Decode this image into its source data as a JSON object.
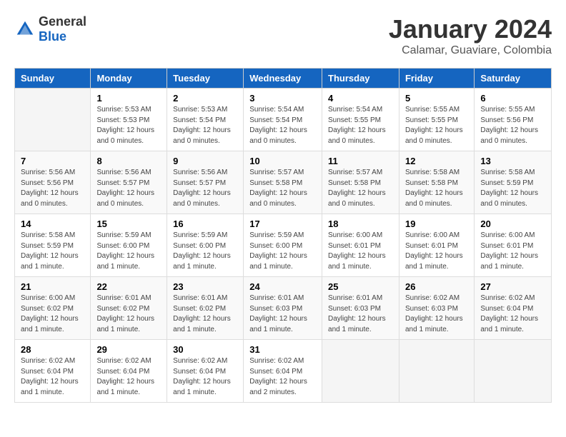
{
  "header": {
    "logo": {
      "general": "General",
      "blue": "Blue"
    },
    "title": "January 2024",
    "subtitle": "Calamar, Guaviare, Colombia"
  },
  "calendar": {
    "days_of_week": [
      "Sunday",
      "Monday",
      "Tuesday",
      "Wednesday",
      "Thursday",
      "Friday",
      "Saturday"
    ],
    "weeks": [
      [
        {
          "day": null,
          "info": null
        },
        {
          "day": "1",
          "info": "Sunrise: 5:53 AM\nSunset: 5:53 PM\nDaylight: 12 hours\nand 0 minutes."
        },
        {
          "day": "2",
          "info": "Sunrise: 5:53 AM\nSunset: 5:54 PM\nDaylight: 12 hours\nand 0 minutes."
        },
        {
          "day": "3",
          "info": "Sunrise: 5:54 AM\nSunset: 5:54 PM\nDaylight: 12 hours\nand 0 minutes."
        },
        {
          "day": "4",
          "info": "Sunrise: 5:54 AM\nSunset: 5:55 PM\nDaylight: 12 hours\nand 0 minutes."
        },
        {
          "day": "5",
          "info": "Sunrise: 5:55 AM\nSunset: 5:55 PM\nDaylight: 12 hours\nand 0 minutes."
        },
        {
          "day": "6",
          "info": "Sunrise: 5:55 AM\nSunset: 5:56 PM\nDaylight: 12 hours\nand 0 minutes."
        }
      ],
      [
        {
          "day": "7",
          "info": "Sunrise: 5:56 AM\nSunset: 5:56 PM\nDaylight: 12 hours\nand 0 minutes."
        },
        {
          "day": "8",
          "info": "Sunrise: 5:56 AM\nSunset: 5:57 PM\nDaylight: 12 hours\nand 0 minutes."
        },
        {
          "day": "9",
          "info": "Sunrise: 5:56 AM\nSunset: 5:57 PM\nDaylight: 12 hours\nand 0 minutes."
        },
        {
          "day": "10",
          "info": "Sunrise: 5:57 AM\nSunset: 5:58 PM\nDaylight: 12 hours\nand 0 minutes."
        },
        {
          "day": "11",
          "info": "Sunrise: 5:57 AM\nSunset: 5:58 PM\nDaylight: 12 hours\nand 0 minutes."
        },
        {
          "day": "12",
          "info": "Sunrise: 5:58 AM\nSunset: 5:58 PM\nDaylight: 12 hours\nand 0 minutes."
        },
        {
          "day": "13",
          "info": "Sunrise: 5:58 AM\nSunset: 5:59 PM\nDaylight: 12 hours\nand 0 minutes."
        }
      ],
      [
        {
          "day": "14",
          "info": "Sunrise: 5:58 AM\nSunset: 5:59 PM\nDaylight: 12 hours\nand 1 minute."
        },
        {
          "day": "15",
          "info": "Sunrise: 5:59 AM\nSunset: 6:00 PM\nDaylight: 12 hours\nand 1 minute."
        },
        {
          "day": "16",
          "info": "Sunrise: 5:59 AM\nSunset: 6:00 PM\nDaylight: 12 hours\nand 1 minute."
        },
        {
          "day": "17",
          "info": "Sunrise: 5:59 AM\nSunset: 6:00 PM\nDaylight: 12 hours\nand 1 minute."
        },
        {
          "day": "18",
          "info": "Sunrise: 6:00 AM\nSunset: 6:01 PM\nDaylight: 12 hours\nand 1 minute."
        },
        {
          "day": "19",
          "info": "Sunrise: 6:00 AM\nSunset: 6:01 PM\nDaylight: 12 hours\nand 1 minute."
        },
        {
          "day": "20",
          "info": "Sunrise: 6:00 AM\nSunset: 6:01 PM\nDaylight: 12 hours\nand 1 minute."
        }
      ],
      [
        {
          "day": "21",
          "info": "Sunrise: 6:00 AM\nSunset: 6:02 PM\nDaylight: 12 hours\nand 1 minute."
        },
        {
          "day": "22",
          "info": "Sunrise: 6:01 AM\nSunset: 6:02 PM\nDaylight: 12 hours\nand 1 minute."
        },
        {
          "day": "23",
          "info": "Sunrise: 6:01 AM\nSunset: 6:02 PM\nDaylight: 12 hours\nand 1 minute."
        },
        {
          "day": "24",
          "info": "Sunrise: 6:01 AM\nSunset: 6:03 PM\nDaylight: 12 hours\nand 1 minute."
        },
        {
          "day": "25",
          "info": "Sunrise: 6:01 AM\nSunset: 6:03 PM\nDaylight: 12 hours\nand 1 minute."
        },
        {
          "day": "26",
          "info": "Sunrise: 6:02 AM\nSunset: 6:03 PM\nDaylight: 12 hours\nand 1 minute."
        },
        {
          "day": "27",
          "info": "Sunrise: 6:02 AM\nSunset: 6:04 PM\nDaylight: 12 hours\nand 1 minute."
        }
      ],
      [
        {
          "day": "28",
          "info": "Sunrise: 6:02 AM\nSunset: 6:04 PM\nDaylight: 12 hours\nand 1 minute."
        },
        {
          "day": "29",
          "info": "Sunrise: 6:02 AM\nSunset: 6:04 PM\nDaylight: 12 hours\nand 1 minute."
        },
        {
          "day": "30",
          "info": "Sunrise: 6:02 AM\nSunset: 6:04 PM\nDaylight: 12 hours\nand 1 minute."
        },
        {
          "day": "31",
          "info": "Sunrise: 6:02 AM\nSunset: 6:04 PM\nDaylight: 12 hours\nand 2 minutes."
        },
        {
          "day": null,
          "info": null
        },
        {
          "day": null,
          "info": null
        },
        {
          "day": null,
          "info": null
        }
      ]
    ]
  }
}
